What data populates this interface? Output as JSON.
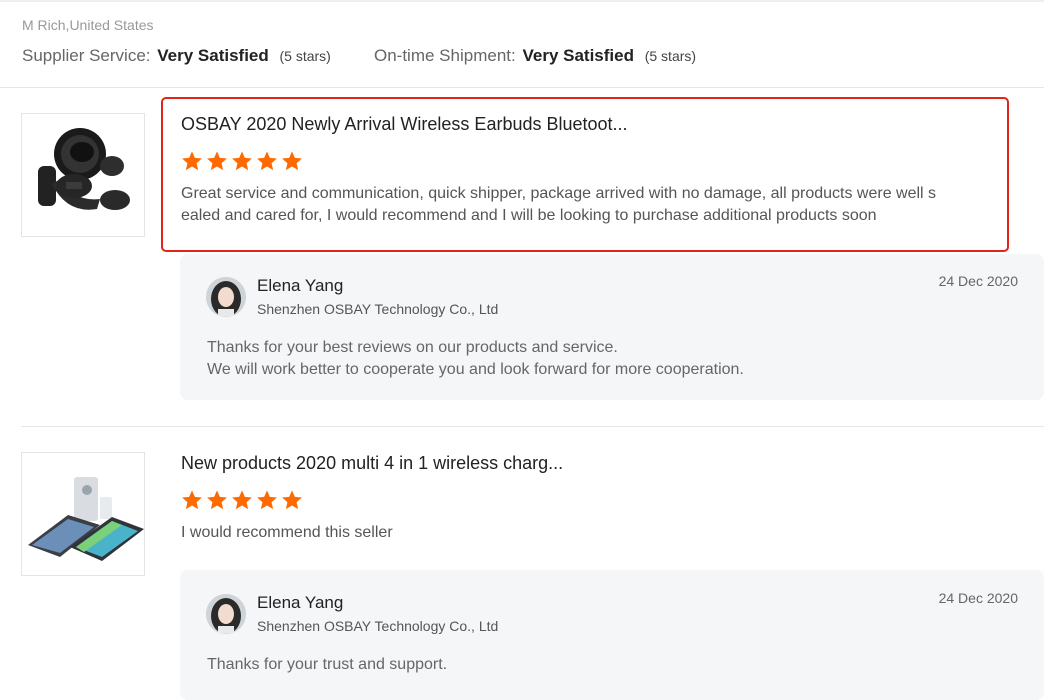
{
  "reviewer": "M Rich,United States",
  "ratings": [
    {
      "label": "Supplier Service:",
      "value": "Very Satisfied",
      "count": "(5 stars)"
    },
    {
      "label": "On-time Shipment:",
      "value": "Very Satisfied",
      "count": "(5 stars)"
    }
  ],
  "reviews": [
    {
      "product_title": "OSBAY 2020 Newly Arrival Wireless Earbuds Bluetoot...",
      "rating": 5,
      "text_line1": "Great service and communication, quick shipper, package arrived with no damage, all products were well s",
      "text_line2": "ealed and cared for, I would recommend and I will be looking to purchase additional products soon",
      "reply": {
        "name": "Elena Yang",
        "company": "Shenzhen OSBAY Technology Co., Ltd",
        "date": "24 Dec 2020",
        "line1": "Thanks for your best reviews on our products and service.",
        "line2": "We will work better to cooperate you and look forward for more cooperation."
      }
    },
    {
      "product_title": "New products 2020 multi 4 in 1 wireless charg...",
      "rating": 5,
      "text_line1": "I would recommend this seller",
      "reply": {
        "name": "Elena Yang",
        "company": "Shenzhen OSBAY Technology Co., Ltd",
        "date": "24 Dec 2020",
        "line1": "Thanks for your trust and support."
      }
    }
  ],
  "colors": {
    "star": "#ff6a00",
    "highlight": "#e1251b",
    "reply_bg": "#f5f6f8"
  },
  "icons": {
    "rating": "star-icon"
  }
}
